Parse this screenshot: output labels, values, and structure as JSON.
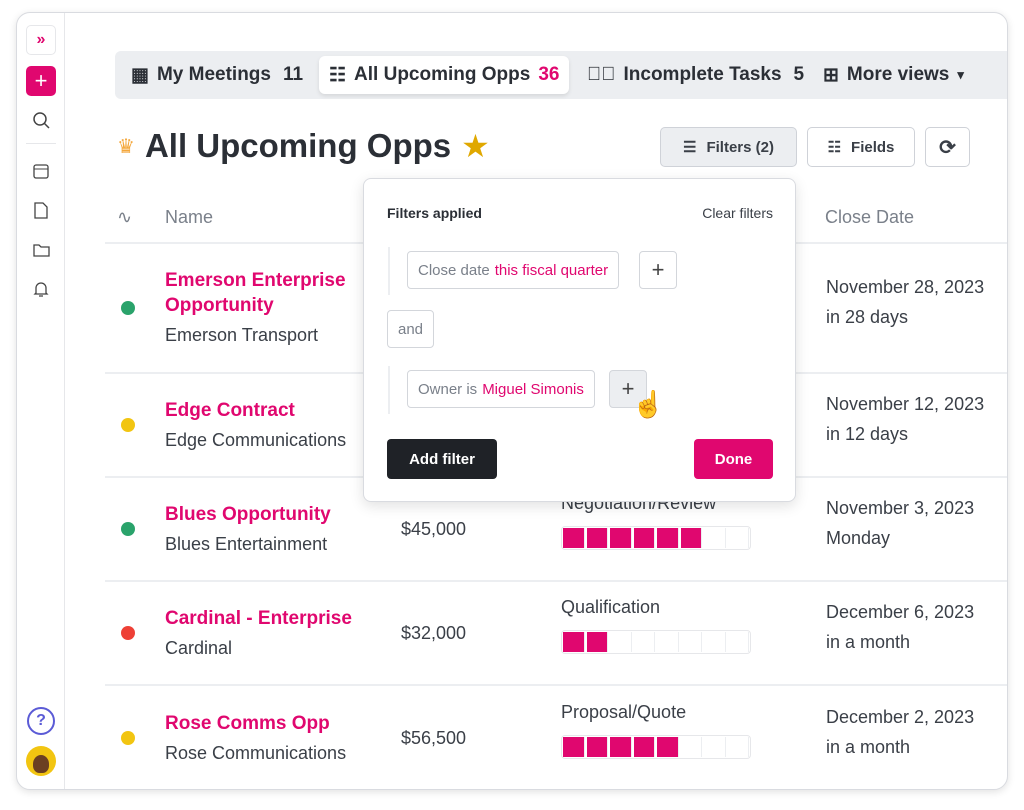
{
  "sidebar": {
    "items": [
      {
        "icon": "logo-icon"
      },
      {
        "icon": "plus-icon"
      },
      {
        "icon": "search-icon"
      },
      {
        "icon": "calendar-icon"
      },
      {
        "icon": "document-icon"
      },
      {
        "icon": "folder-icon"
      },
      {
        "icon": "bell-icon"
      },
      {
        "icon": "help-icon"
      },
      {
        "icon": "avatar"
      }
    ]
  },
  "tabs": [
    {
      "label": "My Meetings",
      "count": "11"
    },
    {
      "label": "All Upcoming Opps",
      "count": "36",
      "active": true
    },
    {
      "label": "Incomplete Tasks",
      "count": "5"
    },
    {
      "label": "More views"
    }
  ],
  "page": {
    "title": "All Upcoming Opps",
    "filters_label": "Filters (2)",
    "fields_label": "Fields"
  },
  "columns": {
    "name": "Name",
    "close_date": "Close Date"
  },
  "rows": [
    {
      "name": "Emerson Enterprise Opportunity",
      "account": "Emerson Transport",
      "date": "November 28, 2023",
      "relative": "in 28 days",
      "status_color": "#2aa36b"
    },
    {
      "name": "Edge Contract",
      "account": "Edge Communications",
      "date": "November 12, 2023",
      "relative": "in 12 days",
      "status_color": "#f2c511"
    },
    {
      "name": "Blues Opportunity",
      "account": "Blues Entertainment",
      "amount": "$45,000",
      "stage": "Negotiation/Review",
      "stage_progress": 6,
      "date": "November 3, 2023",
      "relative": "Monday",
      "status_color": "#2aa36b"
    },
    {
      "name": "Cardinal - Enterprise",
      "account": "Cardinal",
      "amount": "$32,000",
      "stage": "Qualification",
      "stage_progress": 2,
      "date": "December 6, 2023",
      "relative": "in a month",
      "status_color": "#ee4036"
    },
    {
      "name": "Rose Comms Opp",
      "account": "Rose Communications",
      "amount": "$56,500",
      "stage": "Proposal/Quote",
      "stage_progress": 5,
      "date": "December 2, 2023",
      "relative": "in a month",
      "status_color": "#f2c511"
    }
  ],
  "stage_total": 8,
  "popup": {
    "title": "Filters applied",
    "clear": "Clear filters",
    "filter1_field": "Close date",
    "filter1_value": "this fiscal quarter",
    "conj": "and",
    "filter2_field": "Owner is",
    "filter2_value": "Miguel Simonis",
    "add": "Add filter",
    "done": "Done"
  },
  "colors": {
    "accent": "#e0076f",
    "dark": "#1f2227"
  }
}
